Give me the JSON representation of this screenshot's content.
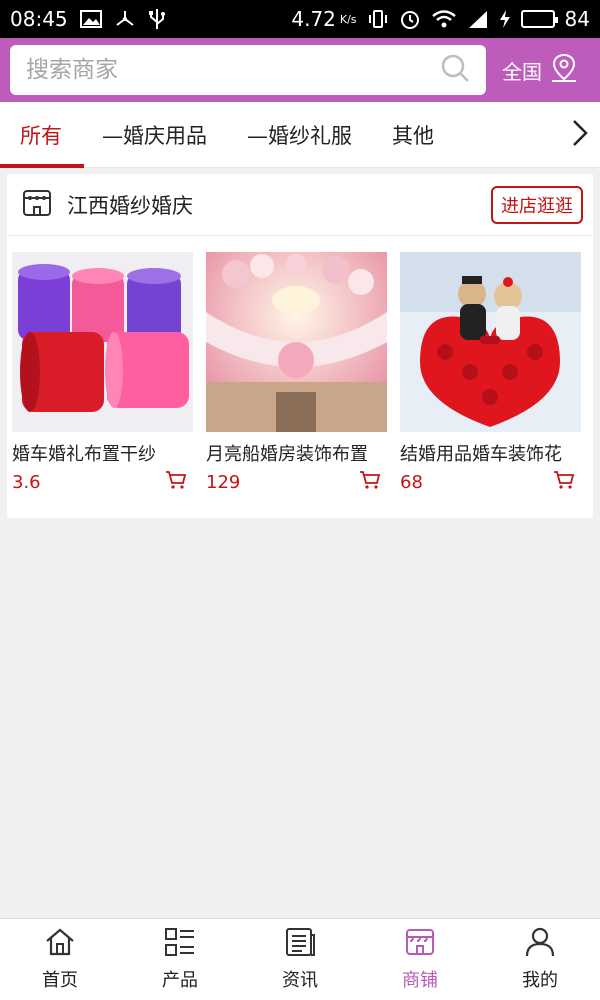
{
  "status_bar": {
    "time": "08:45",
    "network_speed": "4.72",
    "network_unit": "K/s",
    "battery_level": "84",
    "battery_fraction": 0.84
  },
  "header": {
    "search_placeholder": "搜索商家",
    "region_label": "全国",
    "bg_color": "#bd5cba"
  },
  "tabs": [
    {
      "label": "所有",
      "active": true
    },
    {
      "label": "—婚庆用品",
      "active": false
    },
    {
      "label": "—婚纱礼服",
      "active": false
    },
    {
      "label": "其他",
      "active": false
    }
  ],
  "shop": {
    "name": "江西婚纱婚庆",
    "visit_label": "进店逛逛",
    "products": [
      {
        "name": "婚车婚礼布置干纱",
        "price": "3.6"
      },
      {
        "name": "月亮船婚房装饰布置",
        "price": "129"
      },
      {
        "name": "结婚用品婚车装饰花",
        "price": "68"
      }
    ]
  },
  "bottom_nav": [
    {
      "label": "首页",
      "icon": "home-icon",
      "active": false
    },
    {
      "label": "产品",
      "icon": "list-icon",
      "active": false
    },
    {
      "label": "资讯",
      "icon": "news-icon",
      "active": false
    },
    {
      "label": "商铺",
      "icon": "store-icon",
      "active": true
    },
    {
      "label": "我的",
      "icon": "user-icon",
      "active": false
    }
  ],
  "colors": {
    "accent_red": "#c21414",
    "nav_active": "#b75ab9"
  }
}
